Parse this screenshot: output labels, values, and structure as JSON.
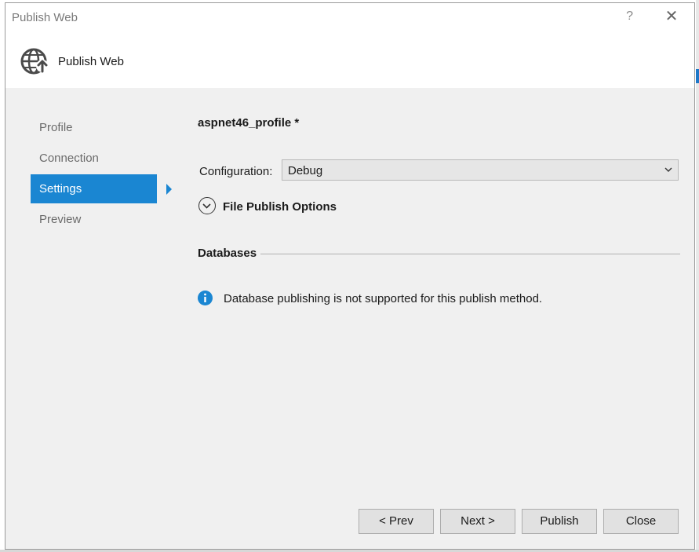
{
  "window": {
    "title": "Publish Web",
    "help_glyph": "?",
    "close_glyph": "✕"
  },
  "header": {
    "title": "Publish Web",
    "icon": "globe-publish-icon"
  },
  "nav": {
    "items": [
      {
        "label": "Profile"
      },
      {
        "label": "Connection"
      },
      {
        "label": "Settings"
      },
      {
        "label": "Preview"
      }
    ],
    "active_index": 2
  },
  "main": {
    "profile_name": "aspnet46_profile *",
    "configuration": {
      "label": "Configuration:",
      "value": "Debug"
    },
    "file_publish_options": {
      "label": "File Publish Options"
    },
    "databases": {
      "label": "Databases",
      "info_text": "Database publishing is not supported for this publish method."
    }
  },
  "footer": {
    "prev_label": "< Prev",
    "next_label": "Next >",
    "publish_label": "Publish",
    "close_label": "Close"
  },
  "colors": {
    "accent": "#1a86d2",
    "info": "#1a86d2",
    "dialog_bg": "#f0f0f0"
  }
}
